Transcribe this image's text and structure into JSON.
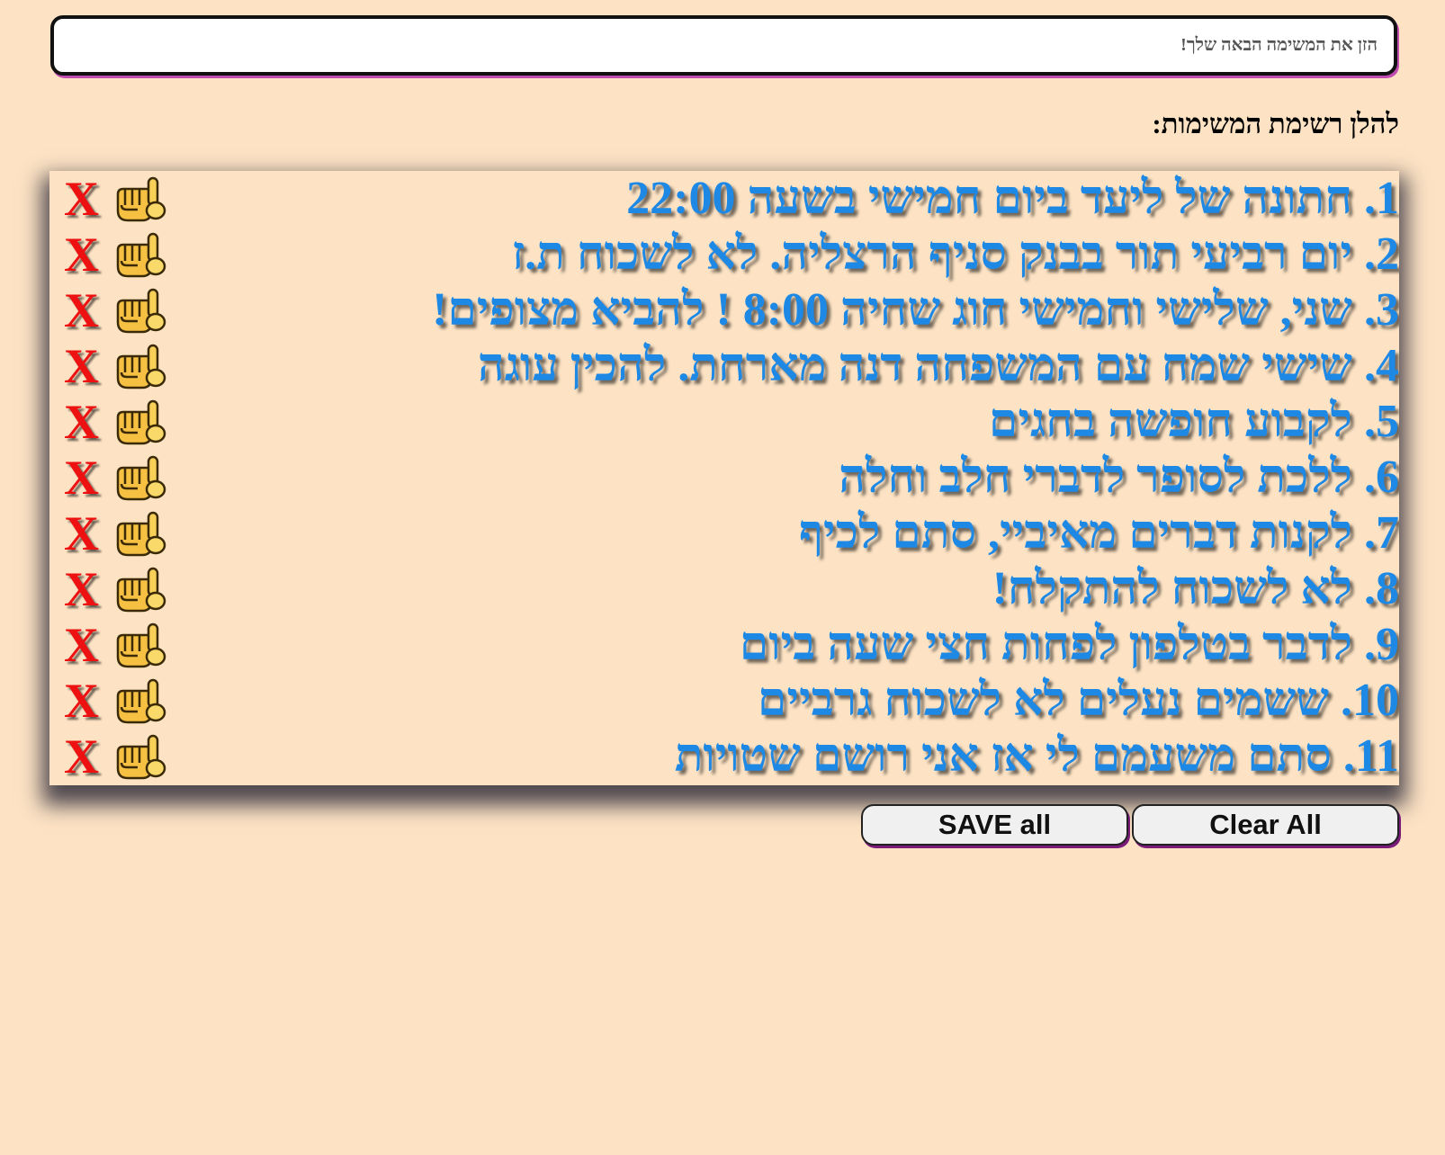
{
  "input": {
    "placeholder": "הזן את המשימה הבאה שלך!"
  },
  "list": {
    "heading": "להלן רשימת המשימות:",
    "delete_label": "X",
    "done_icon": "hand-pointing-icon",
    "text_color": "#1e88e5",
    "delete_color": "#ee1111",
    "items": [
      "1. חתונה של ליעד ביום חמישי בשעה 22:00",
      "2. יום רביעי תור בבנק סניף הרצליה. לא לשכוח ת.ז",
      "3. שני, שלישי וחמישי חוג שחיה 8:00 ! להביא מצופים!",
      "4. שישי שמח עם המשפחה דנה מארחת. להכין עוגה",
      "5. לקבוע חופשה בחגים",
      "6. ללכת לסופר לדברי חלב וחלה",
      "7. לקנות דברים מאיביי, סתם לכיף",
      "8. לא לשכוח להתקלח!",
      "9. לדבר בטלפון לפחות חצי שעה ביום",
      "10. ששמים נעלים לא לשכוח גרביים",
      "11. סתם משעמם לי אז אני רושם שטויות"
    ]
  },
  "buttons": {
    "clear_all": "Clear All",
    "save_all": "SAVE all"
  },
  "colors": {
    "background": "#fde3c4"
  }
}
